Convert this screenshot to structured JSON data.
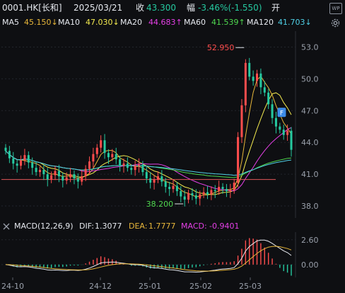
{
  "header": {
    "symbol": "0001.HK[长和]",
    "date": "2025/03/21",
    "close_label": "收",
    "close_value": "43.300",
    "change_label": "幅",
    "change_value": "-3.46%(-1.550)",
    "open_label": "开",
    "badge": "WP"
  },
  "ma_row": {
    "items": [
      {
        "name": "MA5",
        "value": "45.150",
        "arrow": "↓",
        "color": "#e8b73a"
      },
      {
        "name": "MA10",
        "value": "47.030",
        "arrow": "↓",
        "color": "#f2e94e"
      },
      {
        "name": "MA20",
        "value": "44.683",
        "arrow": "↑",
        "color": "#e43fe6"
      },
      {
        "name": "MA60",
        "value": "41.539",
        "arrow": "↑",
        "color": "#4fd84f"
      },
      {
        "name": "MA120",
        "value": "41.703",
        "arrow": "↓",
        "color": "#4fd0e6"
      }
    ]
  },
  "macd_row": {
    "title": "MACD(12,26,9)",
    "dif_label": "DIF:",
    "dif_value": "1.3077",
    "dea_label": "DEA:",
    "dea_value": "1.7777",
    "macd_label": "MACD:",
    "macd_value": "-0.9401"
  },
  "price_axis": [
    "53.0",
    "50.0",
    "47.0",
    "44.0",
    "41.0",
    "38.0"
  ],
  "macd_axis": [
    "2.60",
    "0.00"
  ],
  "x_axis": [
    "24-10",
    "24-12",
    "25-01",
    "25-02",
    "25-03"
  ],
  "annotations": {
    "high": "52.950",
    "low": "38.200",
    "marker": "F"
  },
  "colors": {
    "up": "#ff4d4d",
    "down": "#25c9a0",
    "bg": "#0e0f12"
  },
  "chart_data": {
    "type": "candlestick",
    "y_ticks": [
      53.0,
      50.0,
      47.0,
      44.0,
      41.0,
      38.0
    ],
    "x_ticks": [
      "24-10",
      "24-12",
      "25-01",
      "25-02",
      "25-03"
    ],
    "last_close": 43.3,
    "high_marked": 52.95,
    "low_marked": 38.2,
    "close_series": [
      43.2,
      42.5,
      42.0,
      41.8,
      42.3,
      42.8,
      42.1,
      41.6,
      41.2,
      41.4,
      41.0,
      40.5,
      40.9,
      41.3,
      40.8,
      40.4,
      40.7,
      41.0,
      40.6,
      40.3,
      40.8,
      41.5,
      42.2,
      42.9,
      43.5,
      44.2,
      43.0,
      42.6,
      42.9,
      42.4,
      41.8,
      42.0,
      41.6,
      41.4,
      41.8,
      41.9,
      41.2,
      40.6,
      40.2,
      40.5,
      40.8,
      40.3,
      39.8,
      39.6,
      39.9,
      39.4,
      38.9,
      38.6,
      39.2,
      39.0,
      38.7,
      39.1,
      39.3,
      39.1,
      39.5,
      39.4,
      39.8,
      39.6,
      39.4,
      39.5,
      40.2,
      44.5,
      47.5,
      51.5,
      50.2,
      49.8,
      50.5,
      49.2,
      48.7,
      47.6,
      46.3,
      45.5,
      45.2,
      44.7,
      45.1,
      43.3
    ],
    "macd_ticks": [
      2.6,
      0.0
    ]
  }
}
